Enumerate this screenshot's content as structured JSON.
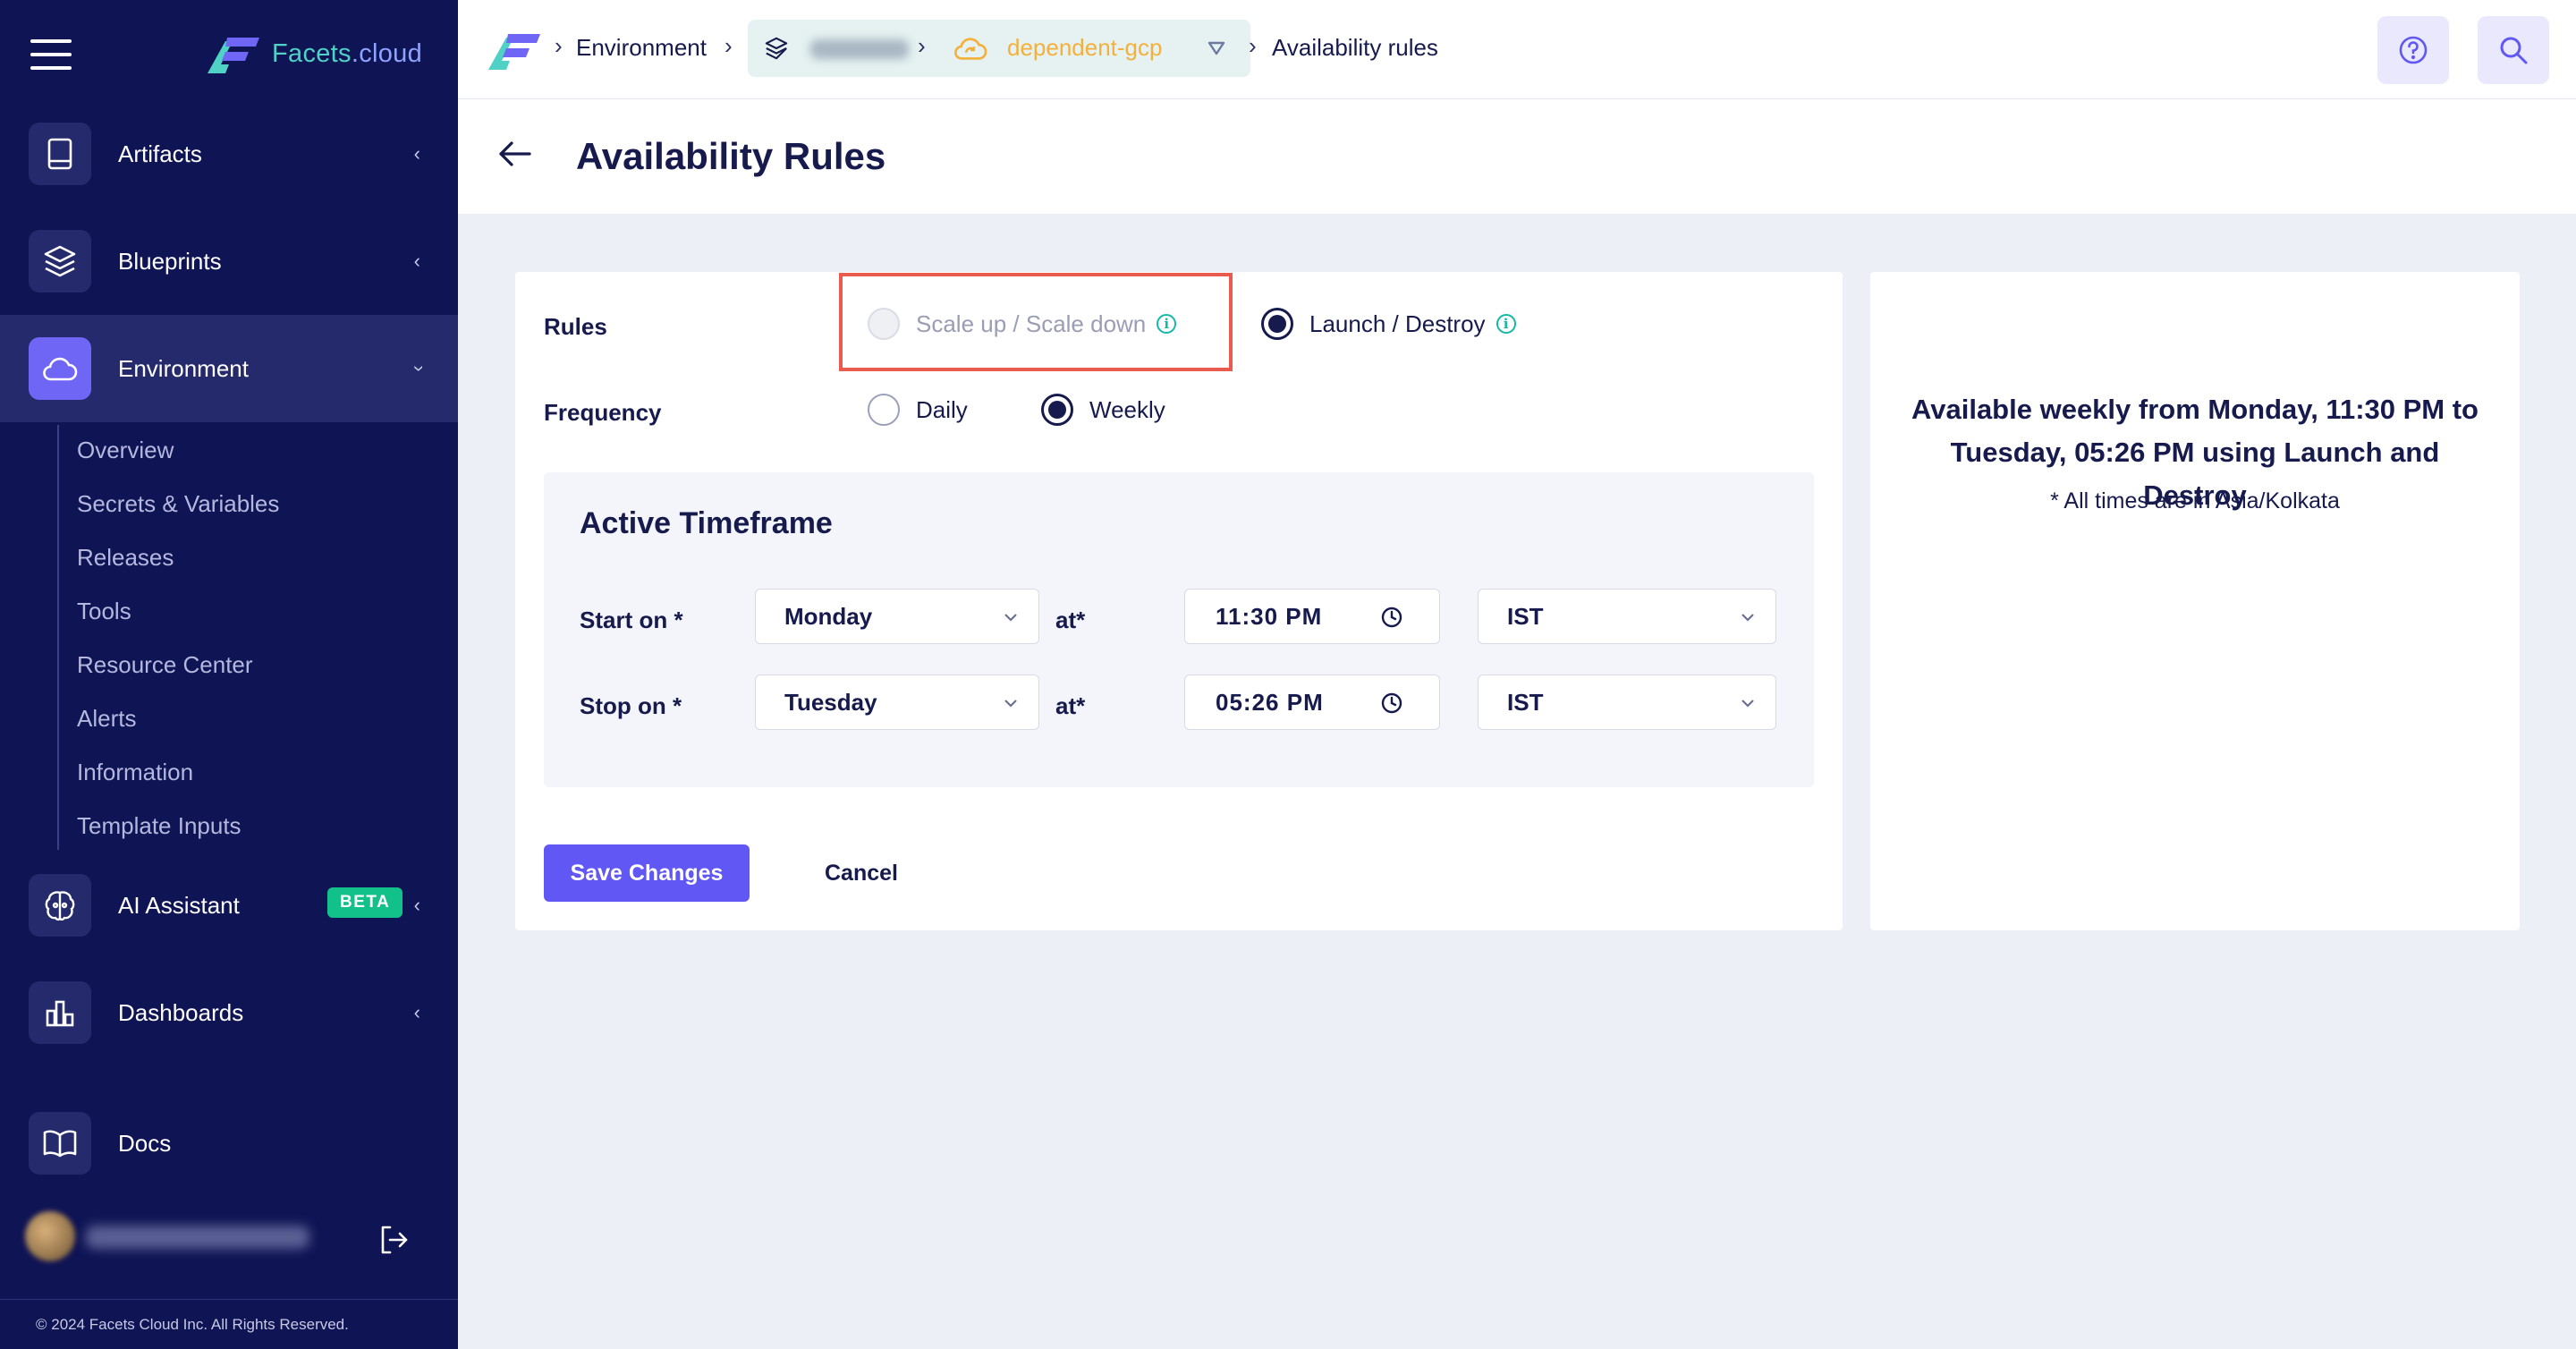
{
  "sidebar": {
    "brand": {
      "name": "Facets",
      "suffix": ".cloud"
    },
    "nav": [
      {
        "label": "Artifacts",
        "icon": "book-icon"
      },
      {
        "label": "Blueprints",
        "icon": "layers-icon"
      },
      {
        "label": "Environment",
        "icon": "cloud-icon",
        "active": true
      },
      {
        "label": "AI Assistant",
        "icon": "brain-icon",
        "badge": "BETA"
      },
      {
        "label": "Dashboards",
        "icon": "bar-chart-icon"
      },
      {
        "label": "Docs",
        "icon": "open-book-icon"
      }
    ],
    "environment_subitems": [
      "Overview",
      "Secrets & Variables",
      "Releases",
      "Tools",
      "Resource Center",
      "Alerts",
      "Information",
      "Template Inputs"
    ],
    "copyright": "© 2024 Facets Cloud Inc. All Rights Reserved."
  },
  "topbar": {
    "breadcrumb": {
      "environment": "Environment",
      "env_name": "dependent-gcp",
      "current": "Availability rules"
    }
  },
  "page": {
    "title": "Availability Rules"
  },
  "form": {
    "rules_label": "Rules",
    "rules_options": {
      "scale": "Scale up / Scale down",
      "launch": "Launch / Destroy"
    },
    "rules_selected": "Launch / Destroy",
    "frequency_label": "Frequency",
    "frequency_options": {
      "daily": "Daily",
      "weekly": "Weekly"
    },
    "frequency_selected": "Weekly",
    "timeframe": {
      "title": "Active Timeframe",
      "start_label": "Start on *",
      "stop_label": "Stop on *",
      "at_label": "at*",
      "start_day": "Monday",
      "start_time": "11:30 PM",
      "start_tz": "IST",
      "stop_day": "Tuesday",
      "stop_time": "05:26 PM",
      "stop_tz": "IST"
    },
    "save_label": "Save Changes",
    "cancel_label": "Cancel"
  },
  "summary": {
    "text": "Available weekly from Monday, 11:30 PM to Tuesday, 05:26 PM using Launch and Destroy",
    "note": "* All times are in Asia/Kolkata"
  },
  "colors": {
    "sidebar_bg": "#0f1454",
    "accent": "#6057f5",
    "teal": "#14b8a6",
    "highlight": "#ea5a4f",
    "env_name": "#f4b03a"
  }
}
